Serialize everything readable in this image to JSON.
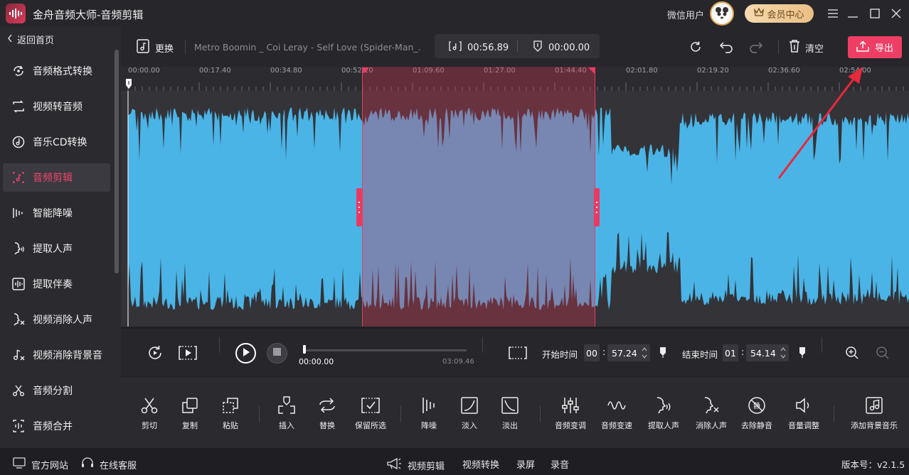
{
  "title_bar": {
    "app_title": "金舟音频大师-音频剪辑",
    "user_name": "微信用户",
    "vip_label": "会员中心"
  },
  "sidebar": {
    "back_label": "返回首页",
    "items": [
      {
        "label": "音频格式转换",
        "icon": "format-convert-icon"
      },
      {
        "label": "视频转音频",
        "icon": "video-to-audio-icon"
      },
      {
        "label": "音乐CD转换",
        "icon": "cd-icon"
      },
      {
        "label": "音频剪辑",
        "icon": "audio-cut-icon",
        "active": true
      },
      {
        "label": "智能降噪",
        "icon": "noise-reduction-icon"
      },
      {
        "label": "提取人声",
        "icon": "extract-vocal-icon"
      },
      {
        "label": "提取伴奏",
        "icon": "extract-accompaniment-icon"
      },
      {
        "label": "视频消除人声",
        "icon": "video-remove-vocal-icon"
      },
      {
        "label": "视频消除背景音",
        "icon": "video-remove-bgm-icon"
      },
      {
        "label": "音频分割",
        "icon": "split-icon"
      },
      {
        "label": "音频合并",
        "icon": "merge-icon"
      }
    ]
  },
  "toolbar": {
    "change_label": "更换",
    "file_name": "Metro Boomin _ Coi Leray - Self Love (Spider-Man_...",
    "duration": "00:56.89",
    "position": "00:00.00",
    "clear_label": "清空",
    "export_label": "导出"
  },
  "ruler": {
    "ticks": [
      "00:00.00",
      "00:17.40",
      "00:34.80",
      "00:52.20",
      "01:09.60",
      "01:27.00",
      "01:44.40",
      "02:01.80",
      "02:19.20",
      "02:36.60",
      "02:54.00"
    ]
  },
  "selection": {
    "start_fraction": 0.3,
    "end_fraction": 0.598
  },
  "transport": {
    "current_time": "00:00.00",
    "total_time": "03:09.46",
    "progress": 0.0,
    "start_label": "开始时间",
    "start_min": "00",
    "start_sec": "57.24",
    "end_label": "结束时间",
    "end_min": "01",
    "end_sec": "54.14"
  },
  "tools": [
    {
      "label": "剪切",
      "icon": "scissors-icon"
    },
    {
      "label": "复制",
      "icon": "copy-icon"
    },
    {
      "label": "粘贴",
      "icon": "paste-icon"
    },
    {
      "label": "插入",
      "icon": "insert-icon"
    },
    {
      "label": "替换",
      "icon": "replace-icon"
    },
    {
      "label": "保留所选",
      "icon": "keep-selection-icon"
    },
    {
      "label": "降噪",
      "icon": "denoise-icon"
    },
    {
      "label": "淡入",
      "icon": "fade-in-icon"
    },
    {
      "label": "淡出",
      "icon": "fade-out-icon"
    },
    {
      "label": "音频变调",
      "icon": "pitch-icon"
    },
    {
      "label": "音频变速",
      "icon": "speed-icon"
    },
    {
      "label": "提取人声",
      "icon": "extract-vocal-icon"
    },
    {
      "label": "消除人声",
      "icon": "remove-vocal-icon"
    },
    {
      "label": "去除静音",
      "icon": "remove-silence-icon"
    },
    {
      "label": "音量调整",
      "icon": "volume-icon"
    },
    {
      "label": "添加背景音乐",
      "icon": "add-bgm-icon"
    }
  ],
  "status_bar": {
    "website": "官方网站",
    "support": "在线客服",
    "video_edit": "视频剪辑",
    "video_convert": "视频转换",
    "record_screen": "录屏",
    "record_audio": "录音",
    "version": "版本号：v2.1.5"
  },
  "colors": {
    "accent": "#ef3e64",
    "waveform": "#4ab4e6",
    "selection": "#c8324f"
  }
}
